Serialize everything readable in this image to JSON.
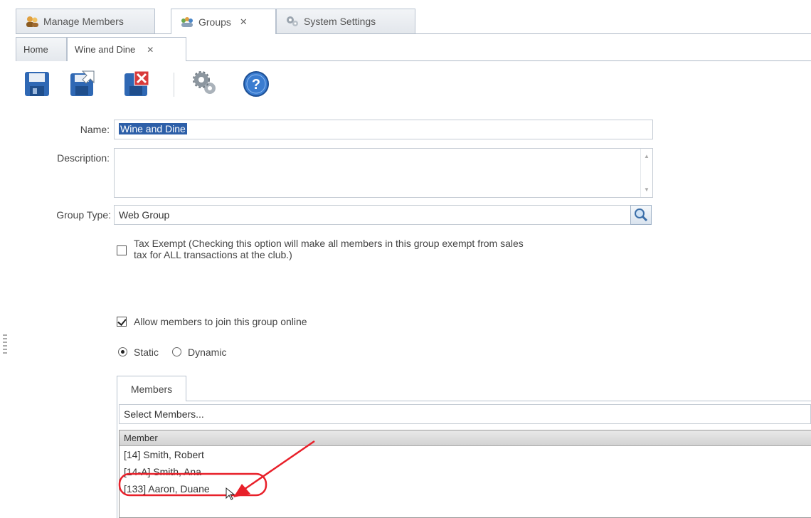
{
  "main_tabs": [
    {
      "label": "Manage Members"
    },
    {
      "label": "Groups",
      "close": "✕"
    },
    {
      "label": "System Settings"
    }
  ],
  "sub_tabs": [
    {
      "label": "Home"
    },
    {
      "label": "Wine and Dine",
      "close": "✕"
    }
  ],
  "form": {
    "name_label": "Name:",
    "name_value": "Wine and Dine",
    "description_label": "Description:",
    "description_value": "",
    "group_type_label": "Group Type:",
    "group_type_value": "Web Group",
    "tax_exempt_line1": "Tax Exempt (Checking this option will make all members in this group exempt from sales",
    "tax_exempt_line2": "tax for ALL transactions at the club.)",
    "tax_exempt_checked": false,
    "allow_online_label": "Allow members to join this group online",
    "allow_online_checked": true,
    "static_label": "Static",
    "dynamic_label": "Dynamic",
    "selected_mode": "Static"
  },
  "members": {
    "tab_label": "Members",
    "select_label": "Select Members...",
    "column_header": "Member",
    "rows": [
      "[14] Smith, Robert",
      "[14-A] Smith, Ana",
      "[133] Aaron, Duane"
    ]
  },
  "colors": {
    "annotation": "#e8202a",
    "selection": "#2d5fa8"
  }
}
